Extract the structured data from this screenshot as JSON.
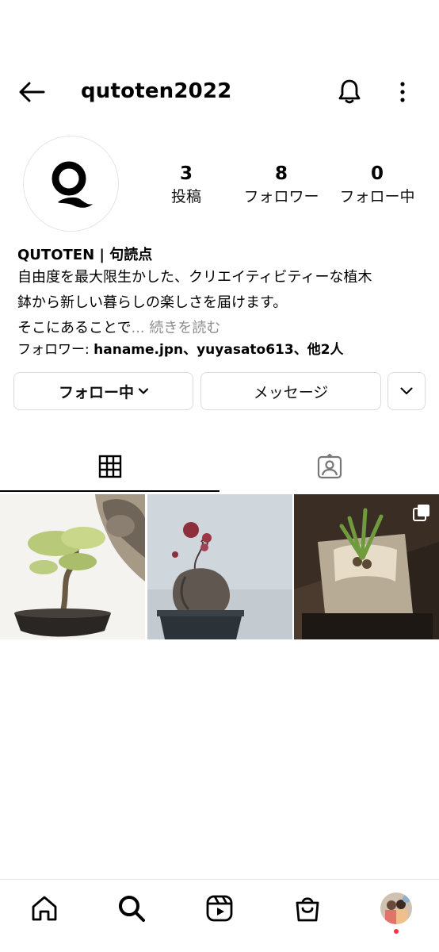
{
  "header": {
    "username": "qutoten2022",
    "back_icon": "arrow-left-icon",
    "bell_icon": "bell-icon",
    "more_icon": "more-vertical-icon"
  },
  "profile": {
    "avatar_icon": "qutoten-logo",
    "stats": [
      {
        "value": "3",
        "label": "投稿"
      },
      {
        "value": "8",
        "label": "フォロワー"
      },
      {
        "value": "0",
        "label": "フォロー中"
      }
    ],
    "bio": {
      "name": "QUTOTEN | 句読点",
      "line1": "自由度を最大限生かした、クリエイティビティーな植木",
      "line2": "鉢から新しい暮らしの楽しさを届けます。",
      "line3_prefix": "そこにあることで",
      "line3_more": "... 続きを読む",
      "followed_prefix": "フォロワー: ",
      "followed_names": "haname.jpn、yuyasato613、他2人"
    }
  },
  "actions": {
    "follow_label": "フォロー中",
    "message_label": "メッセージ"
  },
  "tabs": {
    "grid_icon": "grid-icon",
    "tagged_icon": "tagged-person-icon"
  },
  "posts": [
    {
      "subject": "bonsai-tree-with-cat"
    },
    {
      "subject": "caudex-plant-in-black-pot"
    },
    {
      "subject": "plant-in-stone-pot",
      "multi_image_icon": "carousel-icon"
    }
  ],
  "nav": [
    "home-icon",
    "search-icon",
    "reels-icon",
    "shop-icon",
    "profile-avatar"
  ],
  "colors": {
    "text": "#000000",
    "muted": "#8e8e8e",
    "border": "#dbdbdb",
    "notification_dot": "#ff3040"
  }
}
